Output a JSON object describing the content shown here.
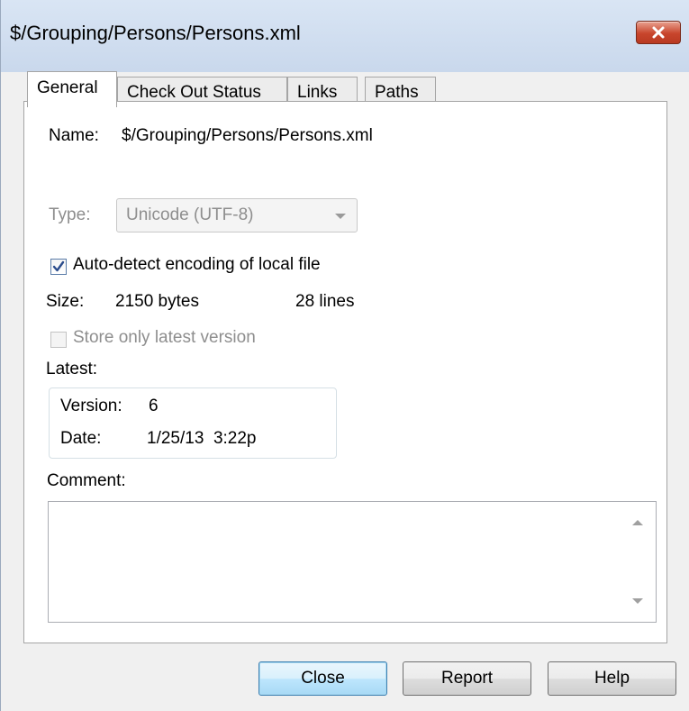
{
  "window": {
    "title": "$/Grouping/Persons/Persons.xml"
  },
  "tabs": [
    {
      "label": "General",
      "active": true
    },
    {
      "label": "Check Out Status",
      "active": false
    },
    {
      "label": "Links",
      "active": false
    },
    {
      "label": "Paths",
      "active": false
    }
  ],
  "general": {
    "name_label": "Name:",
    "name_value": "$/Grouping/Persons/Persons.xml",
    "type_label": "Type:",
    "type_value": "Unicode (UTF-8)",
    "auto_detect_label": "Auto-detect encoding of local file",
    "auto_detect_checked": true,
    "size_label": "Size:",
    "size_bytes": "2150 bytes",
    "size_lines": "28 lines",
    "store_latest_label": "Store only latest version",
    "store_latest_checked": false,
    "latest_label": "Latest:",
    "version_label": "Version:",
    "version_value": "6",
    "date_label": "Date:",
    "date_value": "1/25/13  3:22p",
    "comment_label": "Comment:",
    "comment_value": ""
  },
  "buttons": {
    "close": "Close",
    "report": "Report",
    "help": "Help"
  },
  "colors": {
    "title_bar": "#d3e0f1",
    "close_button": "#c8452c",
    "default_button_border": "#3c7fb1"
  }
}
